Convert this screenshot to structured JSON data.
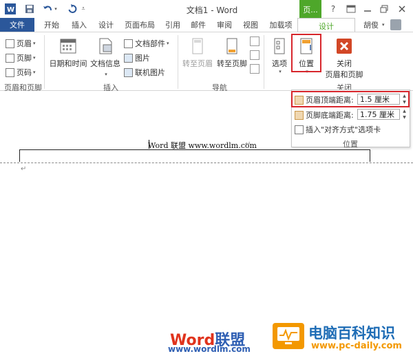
{
  "title_bar": {
    "app_title": "文档1 - Word",
    "context_tab_title": "页...",
    "help_label": "?"
  },
  "tabs": {
    "file": "文件",
    "items": [
      "开始",
      "插入",
      "设计",
      "页面布局",
      "引用",
      "邮件",
      "审阅",
      "视图",
      "加载项"
    ],
    "context_design": "设计",
    "user_name": "胡俊"
  },
  "ribbon": {
    "header_footer_group": {
      "header": "页眉",
      "footer": "页脚",
      "page_number": "页码",
      "label": "页眉和页脚"
    },
    "insert_group": {
      "date_time": "日期和时间",
      "doc_info": "文档信息",
      "quick_parts": "文档部件",
      "picture": "图片",
      "online_picture": "联机图片",
      "label": "插入"
    },
    "nav_group": {
      "goto_header": "转至页眉",
      "goto_footer": "转至页脚",
      "label": "导航"
    },
    "options": "选项",
    "position": "位置",
    "close_group": {
      "close_line1": "关闭",
      "close_line2": "页眉和页脚",
      "label": "关闭"
    }
  },
  "position_panel": {
    "header_from_top_label": "页眉顶端距离:",
    "header_from_top_value": "1.5 厘米",
    "footer_from_bottom_label": "页脚底端距离:",
    "footer_from_bottom_value": "1.75 厘米",
    "insert_align_tab": "插入\"对齐方式\"选项卡",
    "group_label": "位置"
  },
  "document": {
    "header_text": "Word 联盟  www.wordlm.com"
  },
  "watermarks": {
    "left_word": "Word",
    "left_cn": "联盟",
    "left_url": "www.wordlm.com",
    "right_title": "电脑百科知识",
    "right_url": "www.pc-daily.com"
  },
  "colors": {
    "file_tab": "#2b579a",
    "context_green": "#4ea72a",
    "highlight_red": "#d7262c",
    "watermark_orange": "#f39800",
    "watermark_blue": "#1e6cb5"
  }
}
